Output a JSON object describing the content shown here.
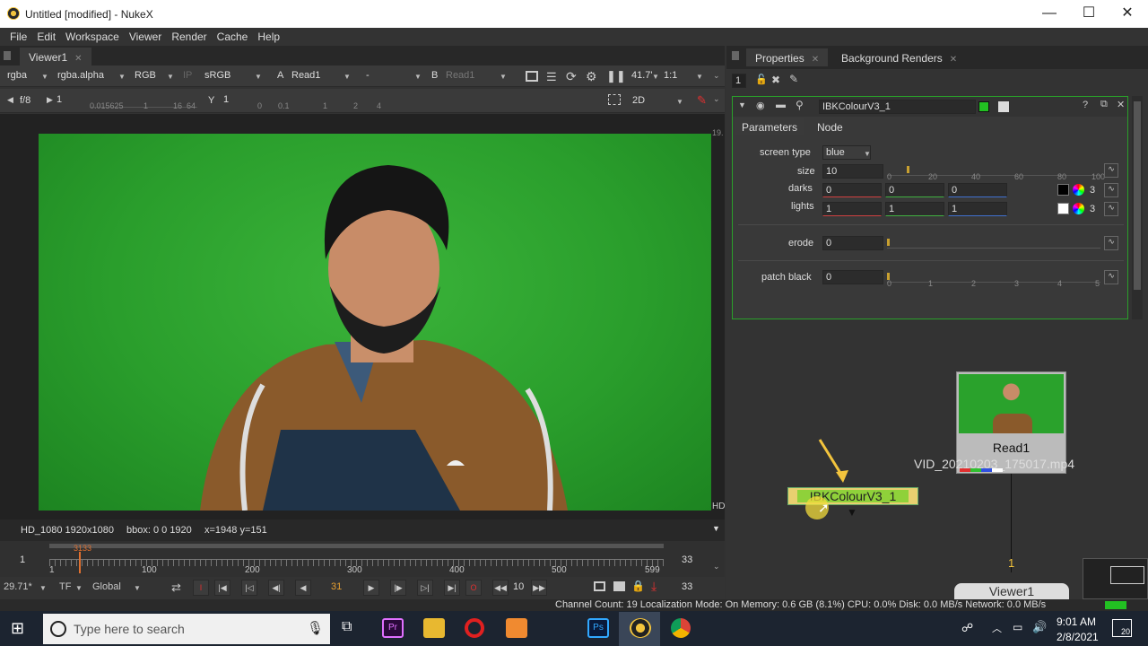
{
  "window": {
    "title": "Untitled [modified] - NukeX",
    "min": "—",
    "max": "☐",
    "close": "✕"
  },
  "menu": [
    "File",
    "Edit",
    "Workspace",
    "Viewer",
    "Render",
    "Cache",
    "Help"
  ],
  "viewer": {
    "tab": "Viewer1",
    "channels": "rgba",
    "alpha": "rgba.alpha",
    "rgb": "RGB",
    "ip": "IP",
    "lut": "sRGB",
    "a_label": "A",
    "a_input": "Read1",
    "dash": "-",
    "b_label": "B",
    "b_input": "Read1",
    "zoom": "41.7'",
    "ratio": "1:1",
    "fstop": "f/8",
    "gain": "1",
    "gain_ticks": [
      "0.015625",
      "1",
      "16",
      "64"
    ],
    "gamma_label": "Y",
    "gamma": "1",
    "gamma_ticks": [
      "0",
      "0.1",
      "1",
      "2",
      "4"
    ],
    "view_mode": "2D",
    "frame_label": "19.",
    "hd_label": "HD"
  },
  "info": {
    "format": "HD_1080 1920x1080",
    "bbox": "bbox: 0 0 1920",
    "coords": "x=1948 y=151"
  },
  "timeline": {
    "start": "1",
    "end": "33",
    "current": "3133",
    "ticks": [
      "1",
      "100",
      "200",
      "300",
      "400",
      "500",
      "599"
    ]
  },
  "playback": {
    "fps": "29.71*",
    "tf": "TF",
    "mode": "Global",
    "frame": "31",
    "step": "10",
    "end_frame": "33"
  },
  "right_tabs": {
    "properties": "Properties",
    "bg_renders": "Background Renders",
    "stack_count": "1"
  },
  "node_props": {
    "name": "IBKColourV3_1",
    "tab_params": "Parameters",
    "tab_node": "Node",
    "screen_type_label": "screen type",
    "screen_type": "blue",
    "size_label": "size",
    "size": "10",
    "size_ticks": [
      "0",
      "20",
      "40",
      "60",
      "80",
      "100"
    ],
    "darks_label": "darks",
    "darks": [
      "0",
      "0",
      "0"
    ],
    "darks_count": "3",
    "lights_label": "lights",
    "lights": [
      "1",
      "1",
      "1"
    ],
    "lights_count": "3",
    "erode_label": "erode",
    "erode": "0",
    "patch_label": "patch black",
    "patch": "0",
    "patch_ticks": [
      "0",
      "1",
      "2",
      "3",
      "4",
      "5"
    ]
  },
  "nodes": {
    "read_name": "Read1",
    "read_file": "VID_20210203_175017.mp4",
    "ibk": "IBKColourV3_1",
    "viewer": "Viewer1",
    "pipe_num": "1"
  },
  "status": "Channel Count: 19  Localization Mode: On  Memory: 0.6 GB (8.1%)  CPU: 0.0%  Disk: 0.0 MB/s  Network: 0.0 MB/s",
  "taskbar": {
    "search": "Type here to search",
    "time": "9:01 AM",
    "date": "2/8/2021",
    "notif": "20"
  },
  "colors": {
    "green_screen": "#2aa22c",
    "accent": "#f3c43d",
    "node_green": "#8fd13a"
  }
}
